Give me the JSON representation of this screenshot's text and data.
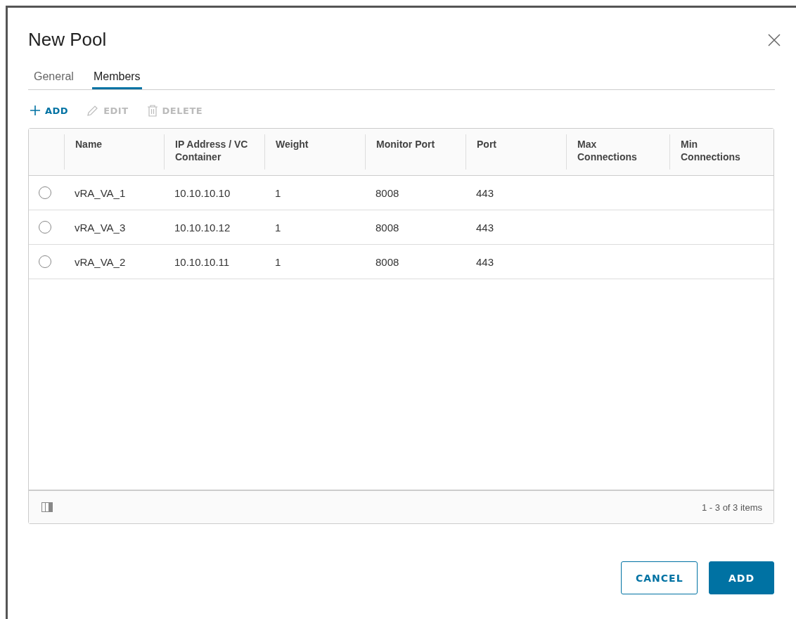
{
  "dialog": {
    "title": "New Pool"
  },
  "tabs": [
    {
      "label": "General",
      "selected": false
    },
    {
      "label": "Members",
      "selected": true
    }
  ],
  "toolbar": [
    {
      "kind": "add",
      "label": "ADD",
      "disabled": false
    },
    {
      "kind": "edit",
      "label": "EDIT",
      "disabled": true
    },
    {
      "kind": "delete",
      "label": "DELETE",
      "disabled": true
    }
  ],
  "table": {
    "columns": [
      "Name",
      "IP Address / VC Container",
      "Weight",
      "Monitor Port",
      "Port",
      "Max Connections",
      "Min Connections"
    ],
    "rows": [
      {
        "selected": false,
        "cells": [
          "vRA_VA_1",
          "10.10.10.10",
          "1",
          "8008",
          "443"
        ]
      },
      {
        "selected": false,
        "cells": [
          "vRA_VA_3",
          "10.10.10.12",
          "1",
          "8008",
          "443"
        ]
      },
      {
        "selected": false,
        "cells": [
          "vRA_VA_2",
          "10.10.10.11",
          "1",
          "8008",
          "443"
        ]
      }
    ],
    "footer": "1 - 3 of 3 items"
  },
  "buttons": [
    {
      "kind": "secondary",
      "label": "CANCEL"
    },
    {
      "kind": "primary",
      "label": "ADD"
    }
  ]
}
